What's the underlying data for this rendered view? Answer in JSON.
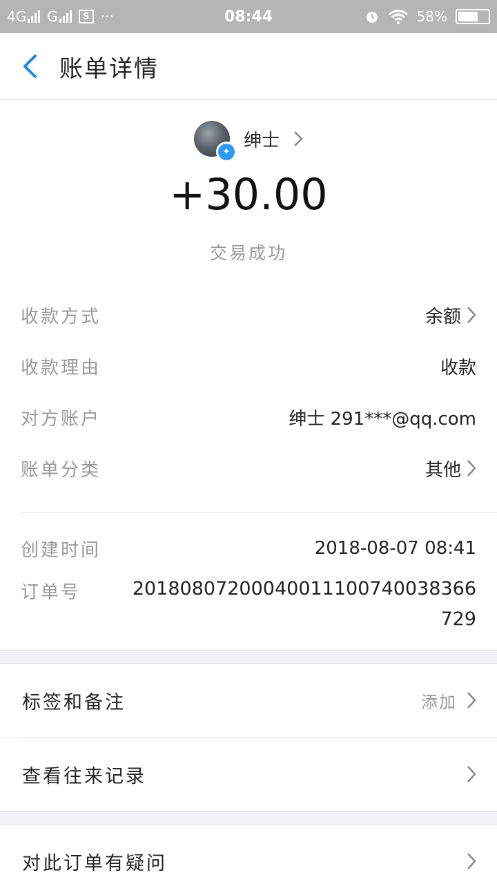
{
  "status_bar": {
    "network1": "4G",
    "network2": "G",
    "sim_icon": "S",
    "dots": "···",
    "time": "08:44",
    "battery": "58%"
  },
  "header": {
    "title": "账单详情"
  },
  "payer": {
    "name": "绅士"
  },
  "amount": "+30.00",
  "status": "交易成功",
  "details": [
    {
      "label": "收款方式",
      "value": "余额",
      "chevron": true
    },
    {
      "label": "收款理由",
      "value": "收款",
      "chevron": false
    },
    {
      "label": "对方账户",
      "value": "绅士 291***@qq.com",
      "chevron": false
    },
    {
      "label": "账单分类",
      "value": "其他",
      "chevron": true
    }
  ],
  "time_info": {
    "created_label": "创建时间",
    "created_value": "2018-08-07 08:41",
    "order_label": "订单号",
    "order_value_line1": "201808072000400111007400383​66",
    "order_value_line2": "729"
  },
  "actions": [
    {
      "label": "标签和备注",
      "value": "添加"
    },
    {
      "label": "查看往来记录",
      "value": ""
    }
  ],
  "footer_action": {
    "label": "对此订单有疑问"
  }
}
